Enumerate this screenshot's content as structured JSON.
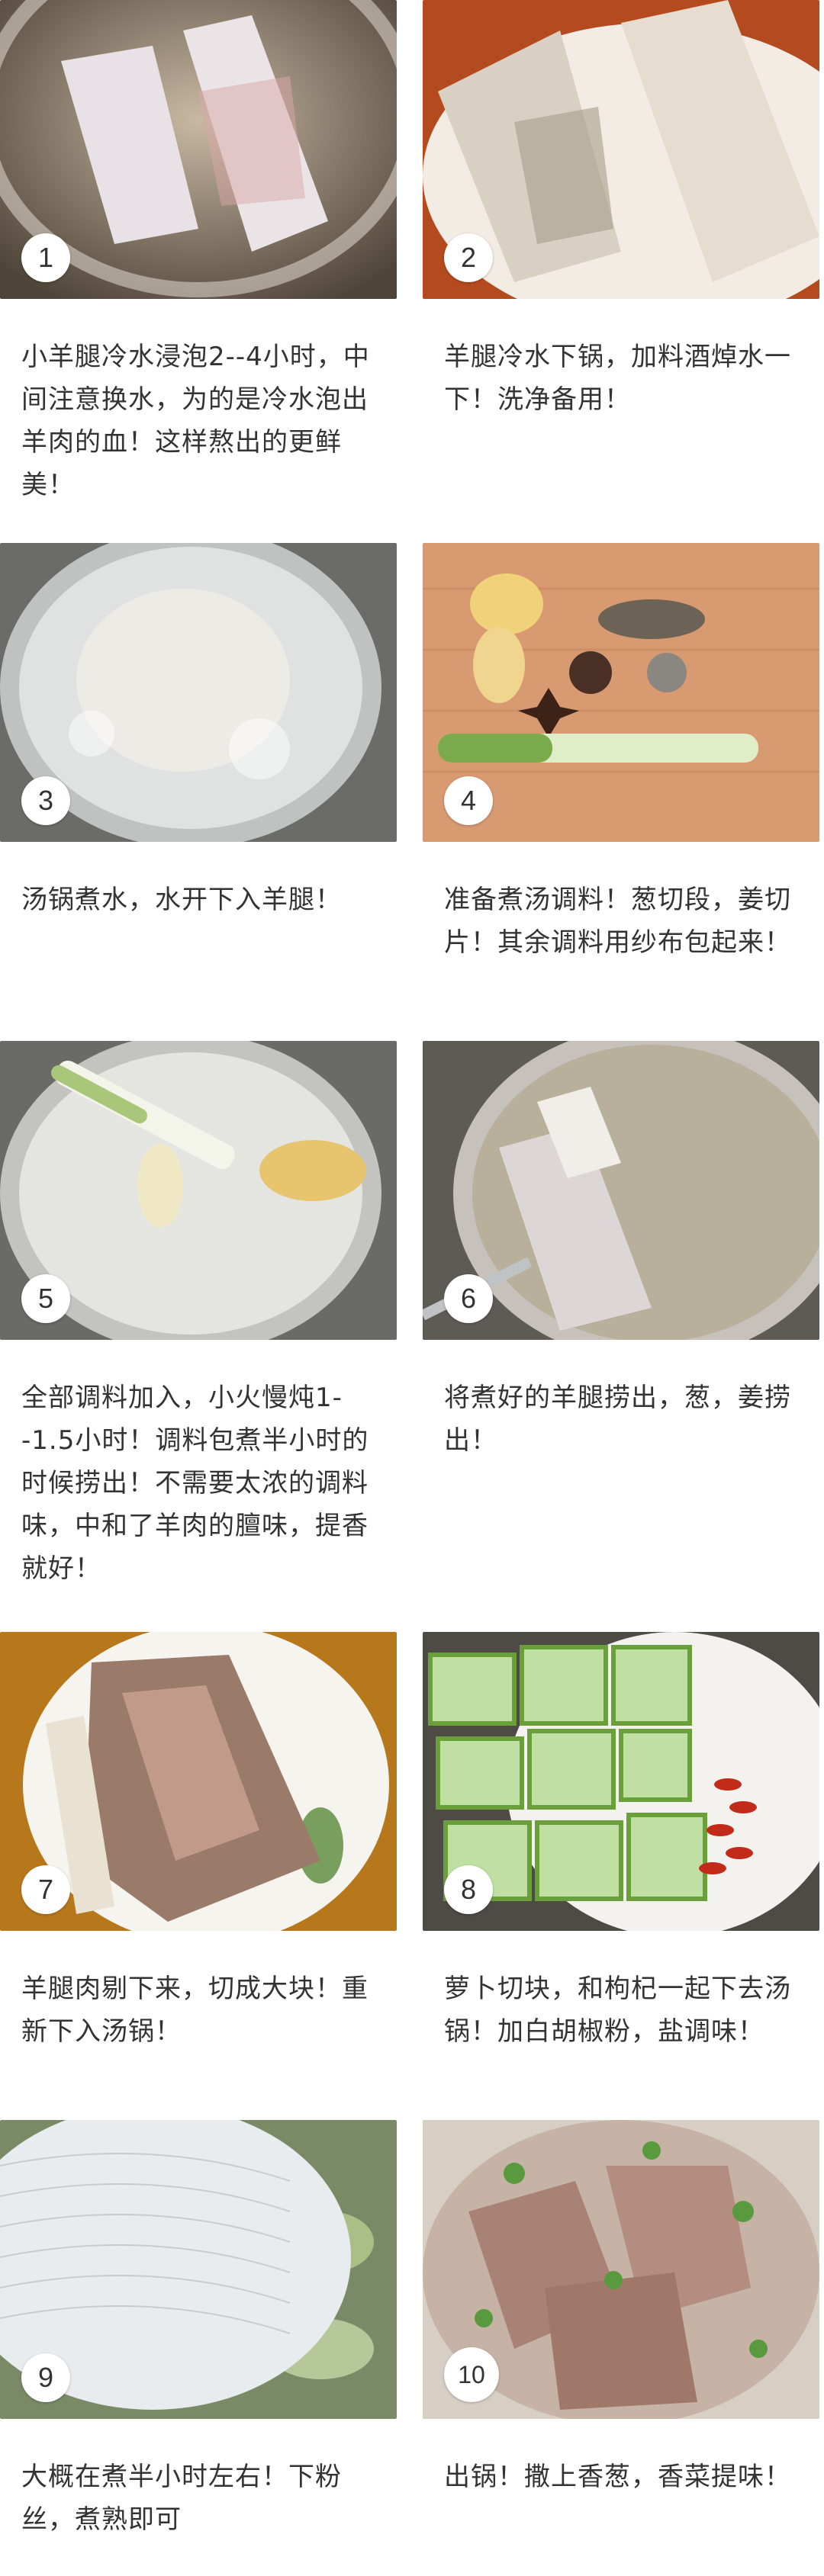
{
  "steps": [
    {
      "number": "1",
      "text": "小羊腿冷水浸泡2--4小时，中间注意换水，为的是冷水泡出羊肉的血！这样熬出的更鲜美！"
    },
    {
      "number": "2",
      "text": "羊腿冷水下锅，加料酒焯水一下！洗净备用！"
    },
    {
      "number": "3",
      "text": "汤锅煮水，水开下入羊腿！"
    },
    {
      "number": "4",
      "text": "准备煮汤调料！葱切段，姜切片！其余调料用纱布包起来！"
    },
    {
      "number": "5",
      "text": "全部调料加入，小火慢炖1--1.5小时！调料包煮半小时的时候捞出！不需要太浓的调料味，中和了羊肉的膻味，提香就好！"
    },
    {
      "number": "6",
      "text": "将煮好的羊腿捞出，葱，姜捞出！"
    },
    {
      "number": "7",
      "text": "羊腿肉剔下来，切成大块！重新下入汤锅！"
    },
    {
      "number": "8",
      "text": "萝卜切块，和枸杞一起下去汤锅！加白胡椒粉，盐调味！"
    },
    {
      "number": "9",
      "text": "大概在煮半小时左右！下粉丝，煮熟即可"
    },
    {
      "number": "10",
      "text": "出锅！撒上香葱，香菜提味！"
    }
  ]
}
